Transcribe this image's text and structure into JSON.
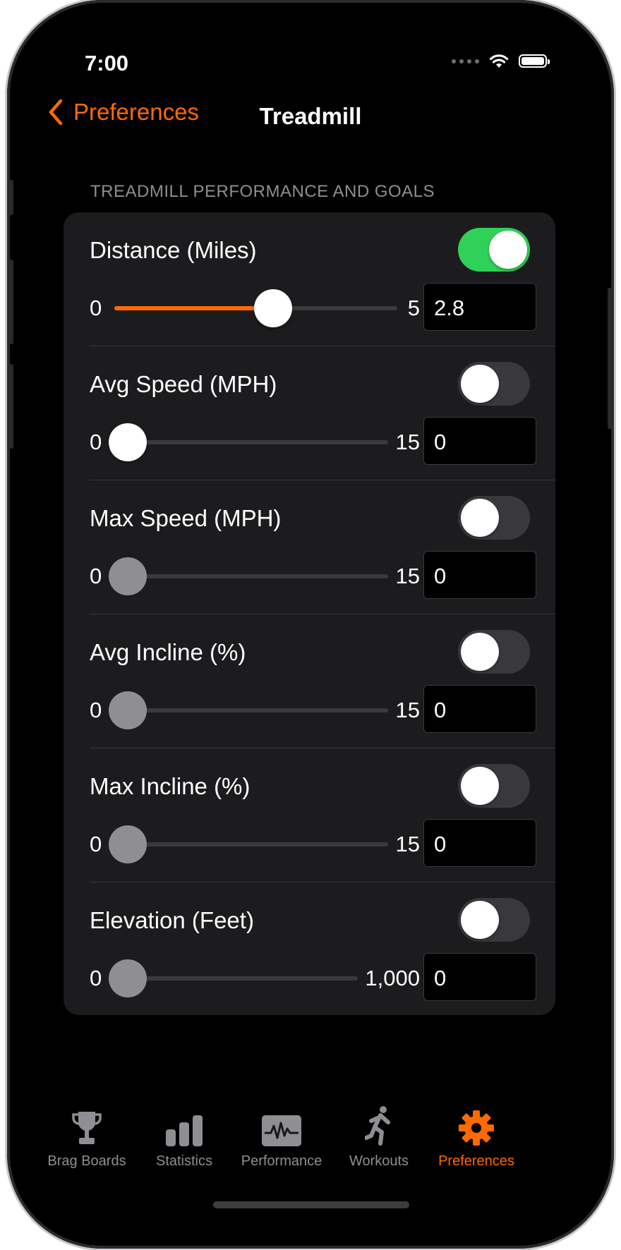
{
  "status": {
    "time": "7:00"
  },
  "nav": {
    "back_label": "Preferences",
    "title": "Treadmill"
  },
  "section": {
    "header": "TREADMILL PERFORMANCE AND GOALS"
  },
  "colors": {
    "accent": "#ff6a00",
    "toggle_on": "#30d158",
    "card": "#1c1c1e"
  },
  "settings": [
    {
      "label": "Distance (Miles)",
      "enabled": true,
      "min": "0",
      "max": "5",
      "value": "2.8",
      "fraction": 0.56
    },
    {
      "label": "Avg Speed (MPH)",
      "enabled": false,
      "min": "0",
      "max": "15",
      "value": "0",
      "fraction": 0
    },
    {
      "label": "Max Speed (MPH)",
      "enabled": false,
      "min": "0",
      "max": "15",
      "value": "0",
      "fraction": 0
    },
    {
      "label": "Avg Incline (%)",
      "enabled": false,
      "min": "0",
      "max": "15",
      "value": "0",
      "fraction": 0
    },
    {
      "label": "Max Incline (%)",
      "enabled": false,
      "min": "0",
      "max": "15",
      "value": "0",
      "fraction": 0
    },
    {
      "label": "Elevation (Feet)",
      "enabled": false,
      "min": "0",
      "max": "1,000",
      "value": "0",
      "fraction": 0
    }
  ],
  "tabs": [
    {
      "label": "Brag Boards",
      "icon": "trophy-icon"
    },
    {
      "label": "Statistics",
      "icon": "bar-chart-icon"
    },
    {
      "label": "Performance",
      "icon": "waveform-icon"
    },
    {
      "label": "Workouts",
      "icon": "running-figure-icon"
    },
    {
      "label": "Preferences",
      "icon": "gear-icon",
      "active": true
    }
  ]
}
